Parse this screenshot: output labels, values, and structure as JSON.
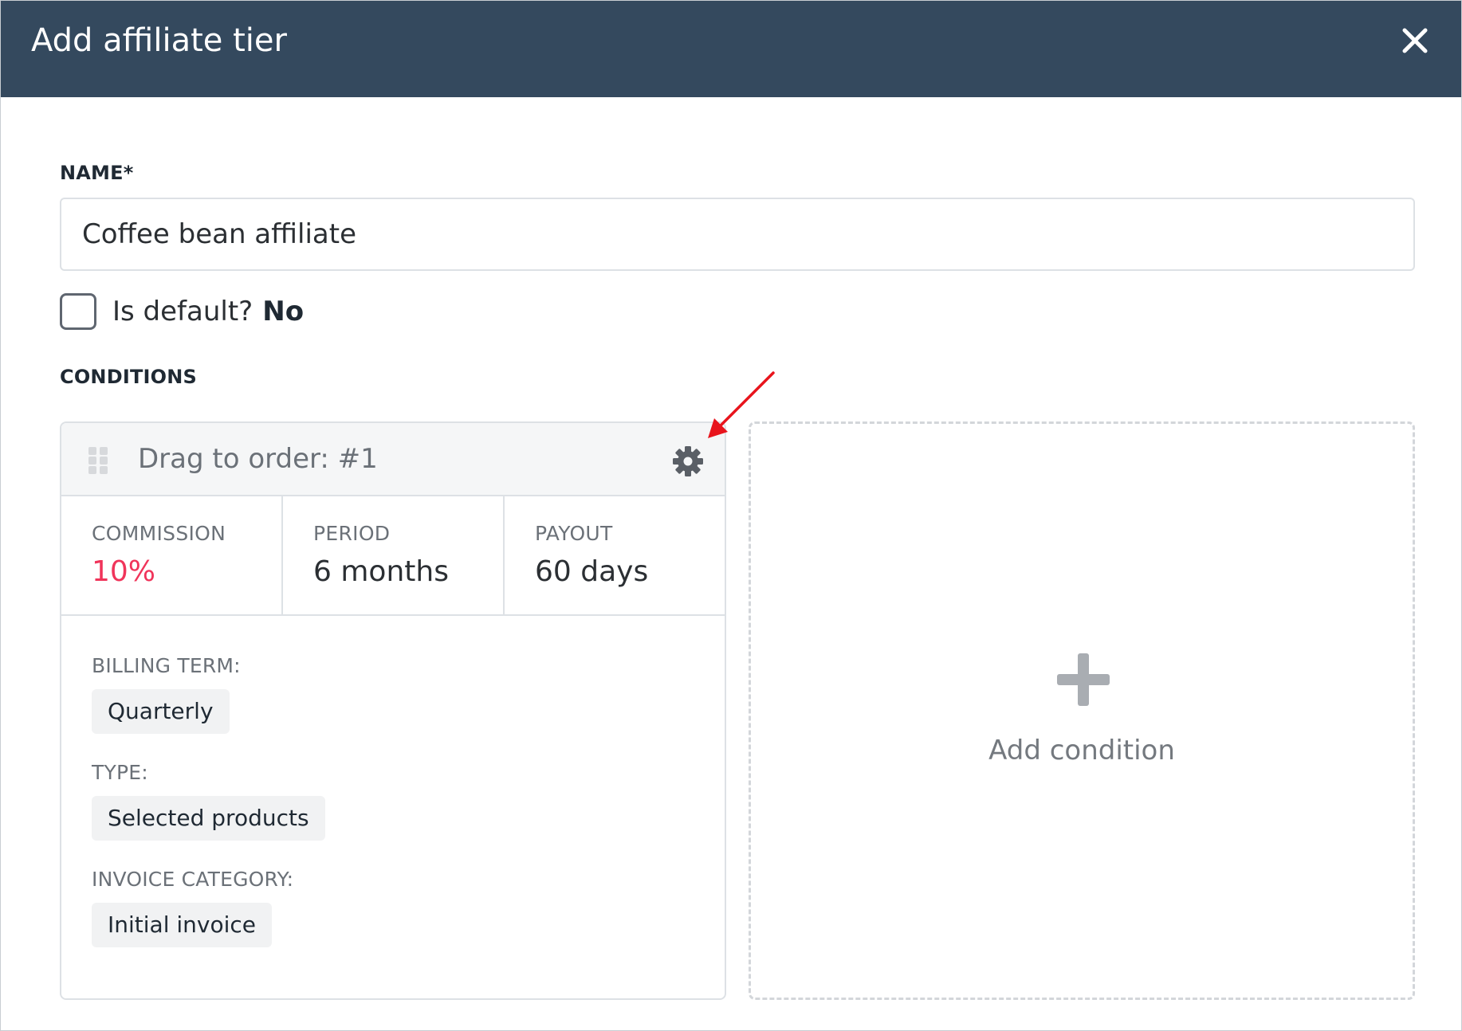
{
  "header": {
    "title": "Add affiliate tier",
    "close_icon": "close-icon"
  },
  "form": {
    "name_label": "NAME*",
    "name_value": "Coffee bean affiliate",
    "is_default_label": "Is default?",
    "is_default_value": "No",
    "is_default_checked": false,
    "conditions_label": "CONDITIONS"
  },
  "condition": {
    "drag_text": "Drag to order: #1",
    "drag_icon": "drag-handle-icon",
    "settings_icon": "gear-icon",
    "stats": [
      {
        "label": "COMMISSION",
        "value": "10%"
      },
      {
        "label": "PERIOD",
        "value": "6 months"
      },
      {
        "label": "PAYOUT",
        "value": "60 days"
      }
    ],
    "details": [
      {
        "label": "BILLING TERM:",
        "value": "Quarterly"
      },
      {
        "label": "TYPE:",
        "value": "Selected products"
      },
      {
        "label": "INVOICE CATEGORY:",
        "value": "Initial invoice"
      }
    ]
  },
  "add_condition": {
    "label": "Add condition",
    "icon": "plus-icon"
  },
  "colors": {
    "header_bg": "#34495e",
    "accent": "#f0345a",
    "annotation": "#e8141c"
  }
}
